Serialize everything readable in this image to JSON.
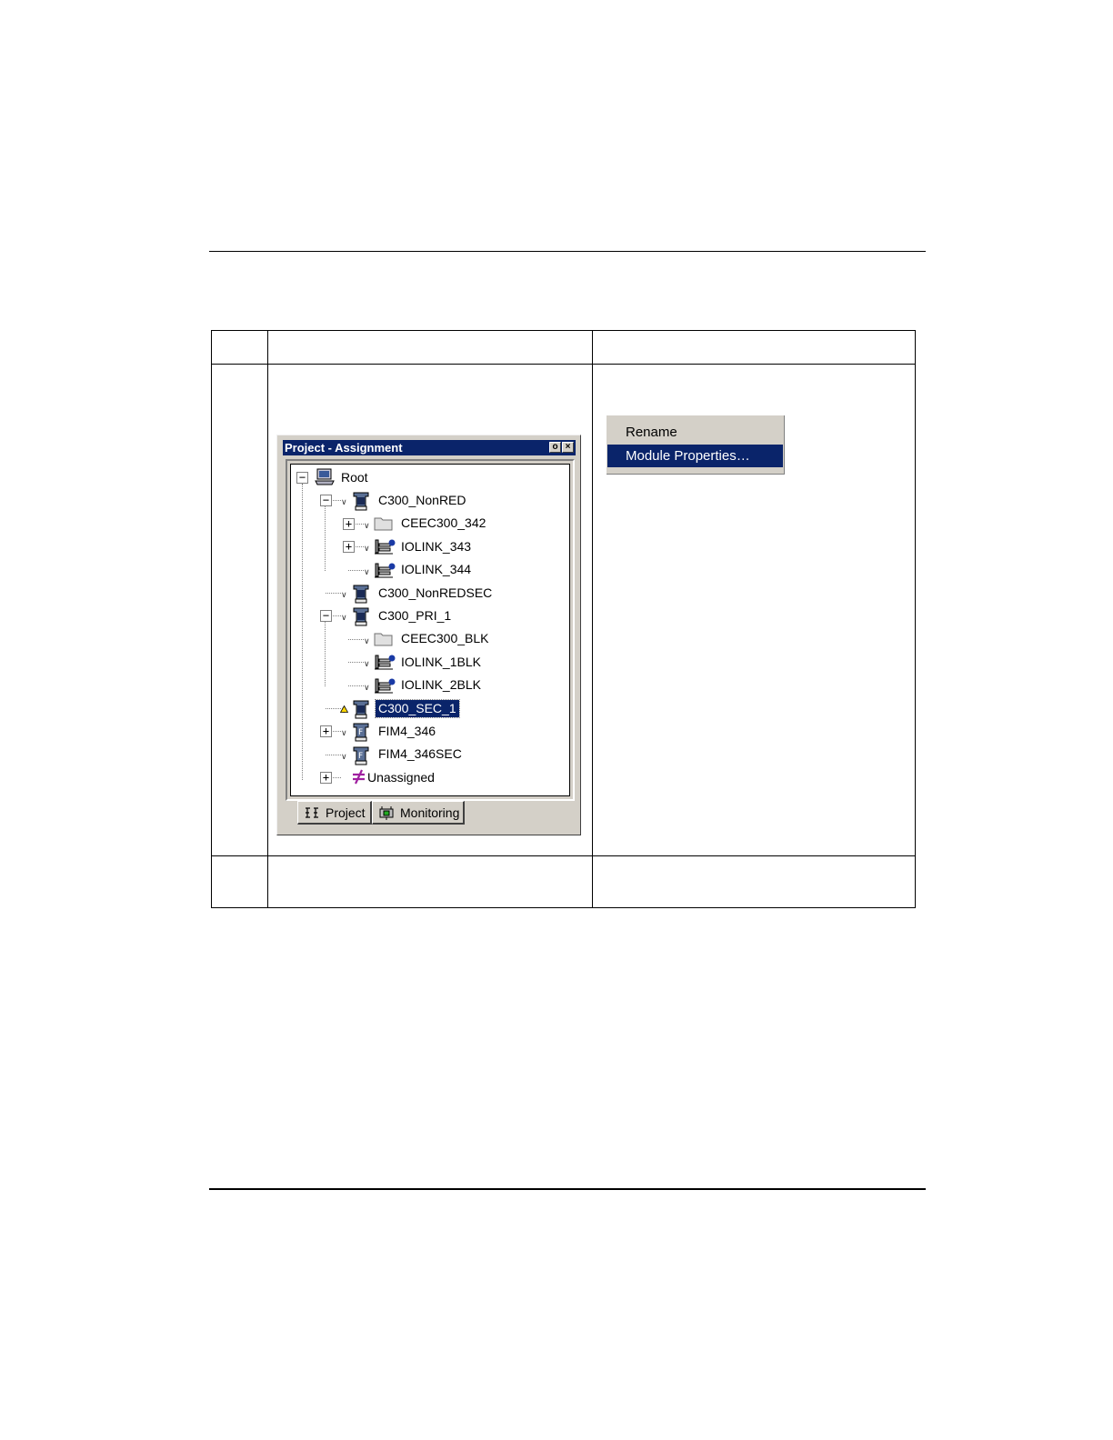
{
  "window": {
    "title": "Project - Assignment",
    "buttons": {
      "pin": "o",
      "close": "×"
    }
  },
  "tree": {
    "items": [
      {
        "label": "Root",
        "icon": "computer-icon",
        "expander": "−"
      },
      {
        "label": "C300_NonRED",
        "icon": "controller-icon",
        "expander": "−"
      },
      {
        "label": "CEEC300_342",
        "icon": "folder-icon",
        "expander": "+"
      },
      {
        "label": "IOLINK_343",
        "icon": "iolink-icon",
        "expander": "+"
      },
      {
        "label": "IOLINK_344",
        "icon": "iolink-icon"
      },
      {
        "label": "C300_NonREDSEC",
        "icon": "controller-icon"
      },
      {
        "label": "C300_PRI_1",
        "icon": "controller-icon",
        "expander": "−"
      },
      {
        "label": "CEEC300_BLK",
        "icon": "folder-icon"
      },
      {
        "label": "IOLINK_1BLK",
        "icon": "iolink-icon"
      },
      {
        "label": "IOLINK_2BLK",
        "icon": "iolink-icon"
      },
      {
        "label": "C300_SEC_1",
        "icon": "controller-icon",
        "selected": true,
        "warning": true
      },
      {
        "label": "FIM4_346",
        "icon": "fim-icon",
        "expander": "+"
      },
      {
        "label": "FIM4_346SEC",
        "icon": "fim-icon"
      },
      {
        "label": "Unassigned",
        "icon": "unassigned-icon",
        "expander": "+"
      }
    ]
  },
  "tabs": [
    {
      "label": "Project",
      "icon": "project-tab-icon"
    },
    {
      "label": "Monitoring",
      "icon": "monitoring-tab-icon"
    }
  ],
  "context_menu": {
    "items": [
      {
        "label": "Rename"
      },
      {
        "label": "Module Properties…",
        "highlighted": true
      }
    ]
  },
  "colors": {
    "titlebar": "#0a246a",
    "selection": "#0a246a",
    "window_face": "#d4d0c8"
  }
}
